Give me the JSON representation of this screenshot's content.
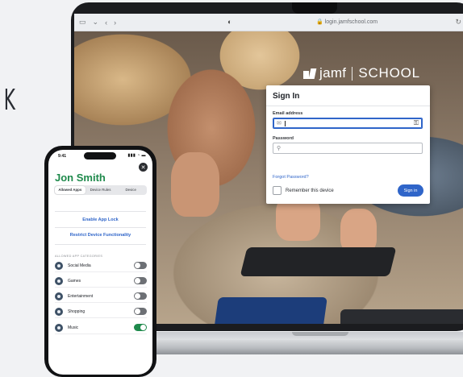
{
  "edge_glyph": "K",
  "browser": {
    "url": "login.jamfschool.com",
    "icons": {
      "sidebar": "sidebar-icon",
      "back": "back-icon",
      "forward": "forward-icon",
      "shield": "shield-icon",
      "lock": "lock-icon"
    }
  },
  "brand": {
    "name": "jamf",
    "product": "SCHOOL"
  },
  "signin": {
    "title": "Sign In",
    "email_label": "Email address",
    "email_value": "",
    "password_label": "Password",
    "password_value": "",
    "forgot_label": "Forgot Password?",
    "remember_label": "Remember this device",
    "remember_checked": false,
    "signin_button": "Sign in"
  },
  "phone": {
    "status": {
      "time": "9:41",
      "signal": "▮▮▮ ◔ ▬"
    },
    "student_name": "Jon Smith",
    "tabs": [
      {
        "label": "Allowed Apps",
        "selected": true
      },
      {
        "label": "Device Rules",
        "selected": false
      },
      {
        "label": "Device",
        "selected": false
      }
    ],
    "actions": [
      {
        "label": "Enable App Lock"
      },
      {
        "label": "Restrict Device Functionality"
      }
    ],
    "section_header": "ALLOWED APP CATEGORIES",
    "categories": [
      {
        "label": "Social Media",
        "enabled": false
      },
      {
        "label": "Games",
        "enabled": false
      },
      {
        "label": "Entertainment",
        "enabled": false
      },
      {
        "label": "Shopping",
        "enabled": false
      },
      {
        "label": "Music",
        "enabled": true
      }
    ]
  },
  "colors": {
    "accent_blue": "#2f65c9",
    "brand_green": "#1f8a4c",
    "toggle_off": "#6d7075"
  }
}
